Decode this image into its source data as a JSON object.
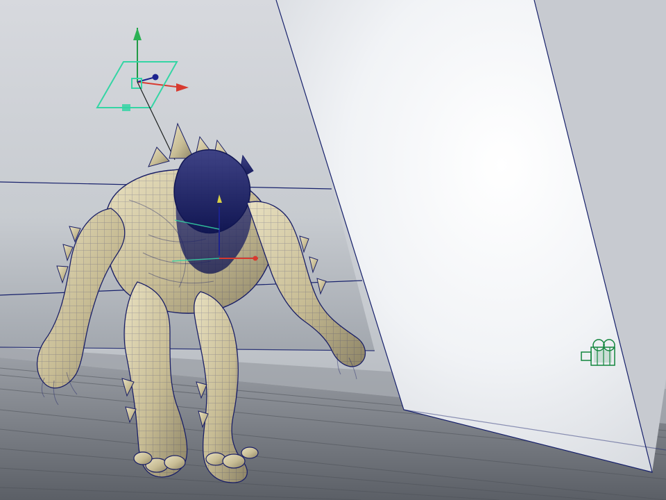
{
  "viewport": {
    "colors": {
      "background": "#a7abb1",
      "wall_left": "#cdd0d5",
      "wall_right": "#f4f6f8",
      "floor": "#7a7e85",
      "wire": "#1a1f66",
      "skin": "#d6cda8",
      "light_manip": "#34d5a4",
      "camera": "#11853c",
      "axis_x": "#d83a2f",
      "axis_y": "#1aa345",
      "axis_z": "#1c238f"
    },
    "icons": {
      "area_light": "area-light-icon",
      "camera": "camera-icon"
    }
  }
}
